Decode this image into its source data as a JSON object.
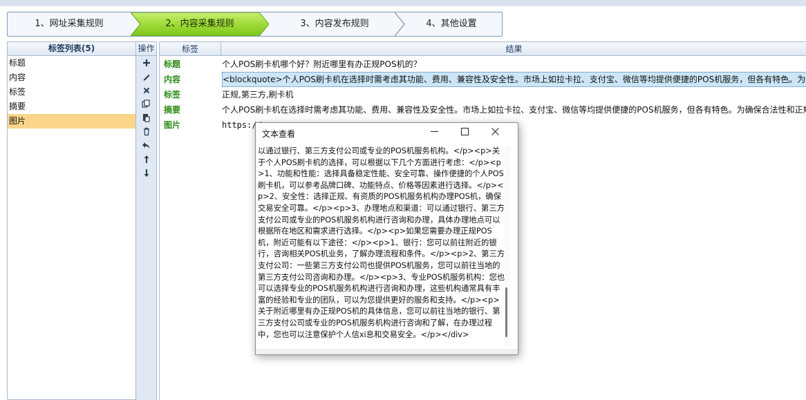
{
  "steps": [
    {
      "label": "1、网址采集规则",
      "active": false
    },
    {
      "label": "2、内容采集规则",
      "active": true
    },
    {
      "label": "3、内容发布规则",
      "active": false
    },
    {
      "label": "4、其他设置",
      "active": false
    }
  ],
  "tag_list": {
    "header": "标签列表(5)",
    "items": [
      "标题",
      "内容",
      "标签",
      "摘要",
      "图片"
    ],
    "selected": "图片"
  },
  "toolbar": {
    "header": "操作",
    "icons": [
      "plus-icon",
      "edit-icon",
      "delete-icon",
      "copy-icon",
      "paste-icon",
      "trash-icon",
      "undo-icon",
      "arrow-up-icon",
      "arrow-down-icon"
    ]
  },
  "grid": {
    "col_tag": "标签",
    "col_result": "结果",
    "rows": [
      {
        "tag": "标题",
        "result": "个人POS刷卡机哪个好？附近哪里有办正规POS机的？"
      },
      {
        "tag": "内容",
        "result": "<blockquote>个人POS刷卡机在选择时需考虑其功能、费用、兼容性及安全性。市场上如拉卡拉、支付宝、微信等均提供便捷的POS机服务，但各有特色。为确保合"
      },
      {
        "tag": "标签",
        "result": "正规,第三方,刷卡机"
      },
      {
        "tag": "摘要",
        "result": "个人POS刷卡机在选择时需考虑其功能、费用、兼容性及安全性。市场上如拉卡拉、支付宝、微信等均提供便捷的POS机服务，但各有特色。为确保合法性和正规性"
      },
      {
        "tag": "图片",
        "result": "https://"
      }
    ]
  },
  "dialog": {
    "title": "文本查看",
    "text": "以通过银行、第三方支付公司或专业的POS机服务机构。</p><p>关于个人POS刷卡机的选择，可以根据以下几个方面进行考虑：</p><p>1、功能和性能：选择具备稳定性能、安全可靠、操作便捷的个人POS刷卡机，可以参考品牌口碑、功能特点、价格等因素进行选择。</p><p>2、安全性：选择正规、有资质的POS机服务机构办理POS机，确保交易安全可靠。</p><p>3、办理地点和渠道：可以通过银行、第三方支付公司或专业的POS机服务机构进行咨询和办理，具体办理地点可以根据所在地区和需求进行选择。</p><p>如果您需要办理正规POS机，附近可能有以下途径：</p><p>1、银行：您可以前往附近的银行，咨询相关POS机业务，了解办理流程和条件。</p><p>2、第三方支付公司：一些第三方支付公司也提供POS机服务，您可以前往当地的第三方支付公司咨询和办理。</p><p>3、专业POS机服务机构：您也可以选择专业的POS机服务机构进行咨询和办理，这些机构通常具有丰富的经验和专业的团队，可以为您提供更好的服务和支持。</p><p>关于附近哪里有办正规POS机的具体信息，您可以前往当地的银行、第三方支付公司或专业的POS机服务机构进行咨询和了解，在办理过程中，您也可以注意保护个人信xi息和交易安全。</p></div>"
  },
  "colors": {
    "active_step": "#8fd12a",
    "selected_row": "#fbd58a",
    "tag_text": "#2d8a14",
    "highlight": "#cde6f7"
  }
}
